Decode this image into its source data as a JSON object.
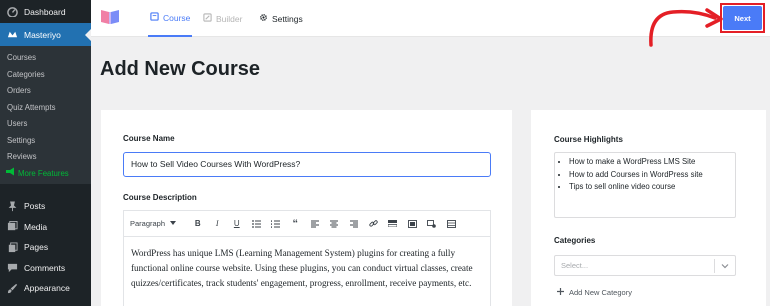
{
  "sidebar": {
    "dashboard": "Dashboard",
    "masteriyo": "Masteriyo",
    "sub_items": [
      "Courses",
      "Categories",
      "Orders",
      "Quiz Attempts",
      "Users",
      "Settings",
      "Reviews"
    ],
    "more_features": "More Features",
    "bottom_items": [
      "Posts",
      "Media",
      "Pages",
      "Comments",
      "Appearance"
    ]
  },
  "topbar": {
    "tabs": [
      "Course",
      "Builder",
      "Settings"
    ],
    "next_label": "Next"
  },
  "page": {
    "title": "Add New Course"
  },
  "course_form": {
    "name_label": "Course Name",
    "name_value": "How to Sell Video Courses With WordPress?",
    "description_label": "Course Description",
    "paragraph_select": "Paragraph",
    "description_text": "WordPress has unique LMS (Learning Management System) plugins for creating a fully functional online course website. Using these plugins, you can conduct virtual classes, create quizzes/certificates, track students' engagement, progress, enrollment, receive payments, etc."
  },
  "sidebar_panel": {
    "highlights_label": "Course Highlights",
    "highlights": [
      "How to make a WordPress LMS Site",
      "How to add Courses in WordPress site",
      "Tips to sell online video course"
    ],
    "categories_label": "Categories",
    "categories_placeholder": "Select...",
    "add_category": "Add New Category"
  },
  "colors": {
    "accent": "#4a7bf7",
    "highlight_red": "#e41f26",
    "sidebar_bg": "#1d2327",
    "sidebar_active": "#2271b1"
  }
}
